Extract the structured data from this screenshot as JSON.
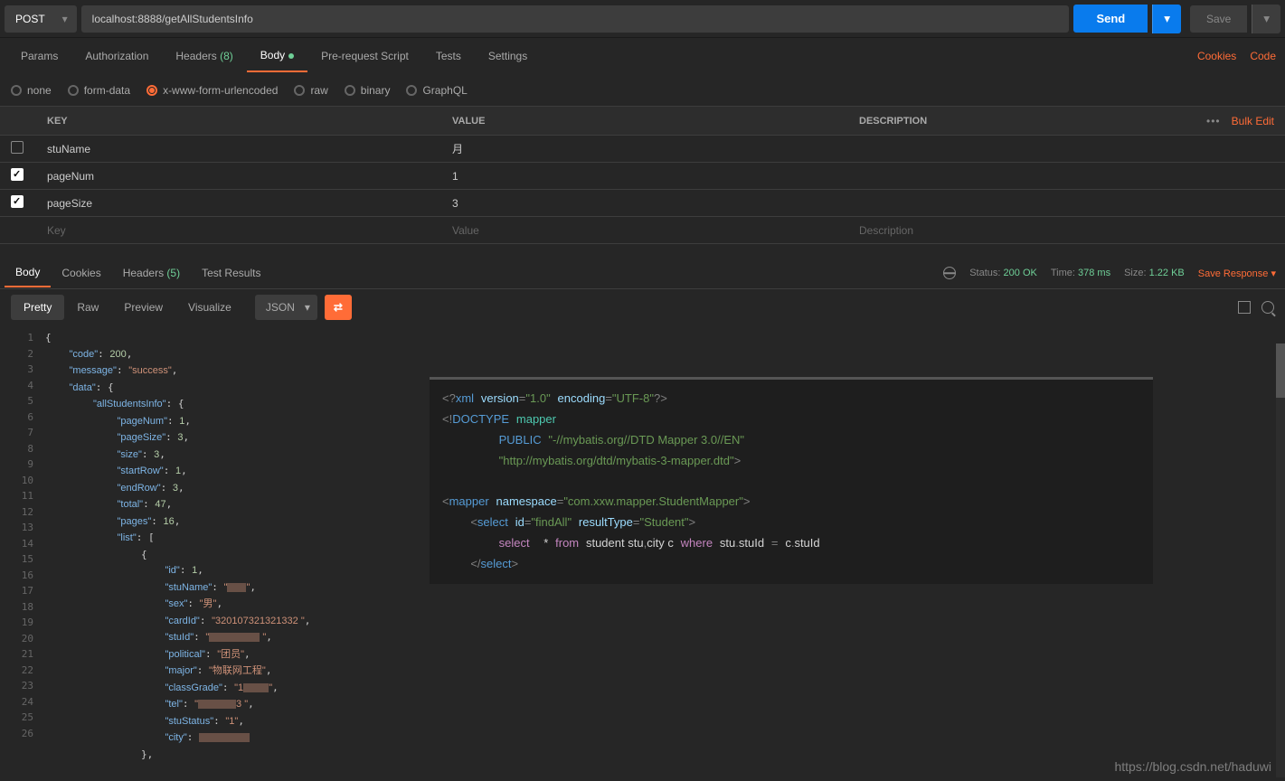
{
  "request": {
    "method": "POST",
    "url": "localhost:8888/getAllStudentsInfo",
    "send": "Send",
    "save": "Save"
  },
  "reqTabs": {
    "params": "Params",
    "authorization": "Authorization",
    "headers": "Headers",
    "headersCount": "(8)",
    "body": "Body",
    "prerequest": "Pre-request Script",
    "tests": "Tests",
    "settings": "Settings",
    "cookies": "Cookies",
    "code": "Code"
  },
  "bodyTypes": {
    "none": "none",
    "formdata": "form-data",
    "urlencoded": "x-www-form-urlencoded",
    "raw": "raw",
    "binary": "binary",
    "graphql": "GraphQL"
  },
  "paramsTable": {
    "headers": {
      "key": "KEY",
      "value": "VALUE",
      "description": "DESCRIPTION"
    },
    "bulkEdit": "Bulk Edit",
    "rows": [
      {
        "checked": false,
        "key": "stuName",
        "value": "月"
      },
      {
        "checked": true,
        "key": "pageNum",
        "value": "1"
      },
      {
        "checked": true,
        "key": "pageSize",
        "value": "3"
      }
    ],
    "placeholder": {
      "key": "Key",
      "value": "Value",
      "description": "Description"
    }
  },
  "respTabs": {
    "body": "Body",
    "cookies": "Cookies",
    "headers": "Headers",
    "headersCount": "(5)",
    "testResults": "Test Results"
  },
  "respStatus": {
    "statusLabel": "Status:",
    "statusValue": "200 OK",
    "timeLabel": "Time:",
    "timeValue": "378 ms",
    "sizeLabel": "Size:",
    "sizeValue": "1.22 KB",
    "saveResponse": "Save Response"
  },
  "viewTabs": {
    "pretty": "Pretty",
    "raw": "Raw",
    "preview": "Preview",
    "visualize": "Visualize",
    "format": "JSON"
  },
  "jsonLines": [
    "{",
    "    \"code\": 200,",
    "    \"message\": \"success\",",
    "    \"data\": {",
    "        \"allStudentsInfo\": {",
    "            \"pageNum\": 1,",
    "            \"pageSize\": 3,",
    "            \"size\": 3,",
    "            \"startRow\": 1,",
    "            \"endRow\": 3,",
    "            \"total\": 47,",
    "            \"pages\": 16,",
    "            \"list\": [",
    "                {",
    "                    \"id\": 1,",
    "                    \"stuName\": \"███\",",
    "                    \"sex\": \"男\",",
    "                    \"cardId\": \"320107321321332 \",",
    "                    \"stuId\": \"████████ \",",
    "                    \"political\": \"团员\",",
    "                    \"major\": \"物联网工程\",",
    "                    \"classGrade\": \"1████\",",
    "                    \"tel\": \"██████3 \",",
    "                    \"stuStatus\": \"1\",",
    "                    \"city\": ████████",
    "                },"
  ],
  "xmlOverlay": {
    "line1": "<?xml version=\"1.0\" encoding=\"UTF-8\"?>",
    "line2": "<!DOCTYPE mapper",
    "line3": "        PUBLIC \"-//mybatis.org//DTD Mapper 3.0//EN\"",
    "line4": "        \"http://mybatis.org/dtd/mybatis-3-mapper.dtd\">",
    "line5": "<mapper namespace=\"com.xxw.mapper.StudentMapper\">",
    "line6": "    <select id=\"findAll\" resultType=\"Student\">",
    "line7": "        select  * from student stu,city c where stu.stuId = c.stuId",
    "line8": "    </select>"
  },
  "watermark": "https://blog.csdn.net/haduwi"
}
